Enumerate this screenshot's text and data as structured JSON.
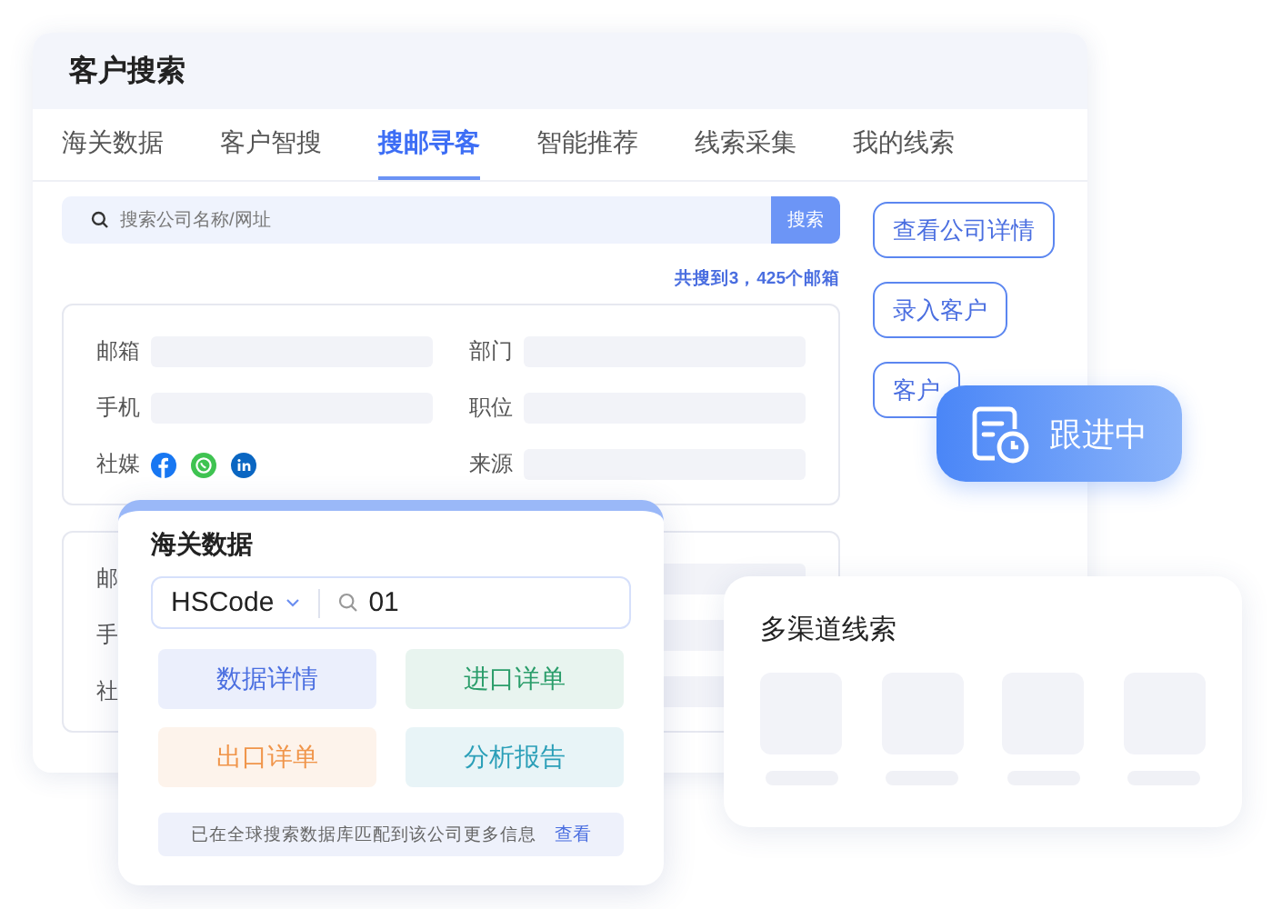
{
  "window": {
    "title": "客户搜索"
  },
  "tabs": [
    {
      "label": "海关数据",
      "selected": false
    },
    {
      "label": "客户智搜",
      "selected": false
    },
    {
      "label": "搜邮寻客",
      "selected": true
    },
    {
      "label": "智能推荐",
      "selected": false
    },
    {
      "label": "线索采集",
      "selected": false
    },
    {
      "label": "我的线索",
      "selected": false
    }
  ],
  "search": {
    "placeholder": "搜索公司名称/网址",
    "button": "搜索"
  },
  "result_count": "共搜到3，425个邮箱",
  "results": [
    {
      "fields": [
        {
          "label": "邮箱",
          "kind": "bar"
        },
        {
          "label": "部门",
          "kind": "bar"
        },
        {
          "label": "手机",
          "kind": "bar"
        },
        {
          "label": "职位",
          "kind": "bar"
        },
        {
          "label": "社媒",
          "kind": "social"
        },
        {
          "label": "来源",
          "kind": "bar"
        }
      ]
    },
    {
      "fields": [
        {
          "label": "邮",
          "kind": "label"
        },
        {
          "kind": "bar"
        },
        {
          "label": "手",
          "kind": "label"
        },
        {
          "kind": "bar"
        },
        {
          "label": "社",
          "kind": "label"
        },
        {
          "kind": "bar"
        }
      ]
    }
  ],
  "actions": [
    "查看公司详情",
    "录入客户",
    "客户"
  ],
  "status_badge": {
    "label": "跟进中"
  },
  "customs_popup": {
    "title": "海关数据",
    "select": "HSCode",
    "query": "01",
    "buttons": [
      {
        "label": "数据详情",
        "color": "#4a6ee0"
      },
      {
        "label": "进口详单",
        "color": "#2a9d6a"
      },
      {
        "label": "出口详单",
        "color": "#f0954a"
      },
      {
        "label": "分析报告",
        "color": "#2b9fb8"
      }
    ],
    "note": {
      "text": "已在全球搜索数据库匹配到该公司更多信息",
      "link": "查看"
    }
  },
  "channels_card": {
    "title": "多渠道线索",
    "tiles": [
      {
        "kind": "placeholder"
      },
      {
        "kind": "placeholder"
      },
      {
        "kind": "placeholder"
      },
      {
        "kind": "placeholder"
      }
    ]
  }
}
